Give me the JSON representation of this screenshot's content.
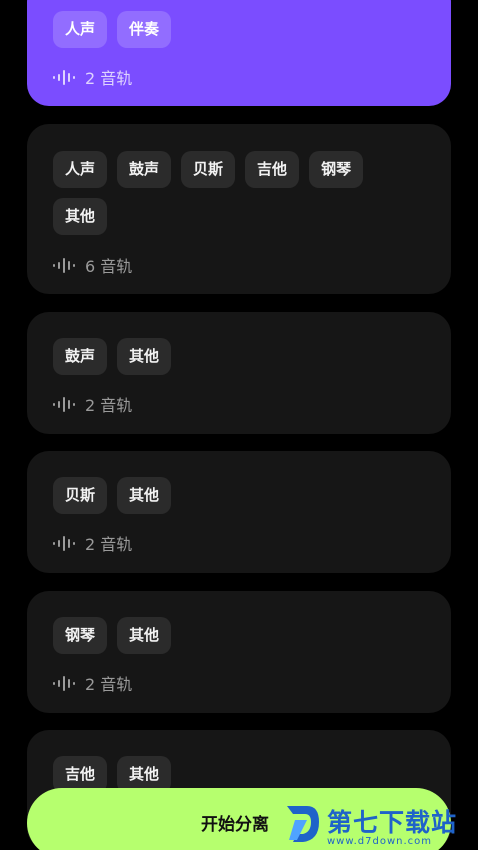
{
  "options": [
    {
      "tags": [
        "人声",
        "伴奏"
      ],
      "track_count": "2 音轨",
      "selected": true
    },
    {
      "tags": [
        "人声",
        "鼓声",
        "贝斯",
        "吉他",
        "钢琴",
        "其他"
      ],
      "track_count": "6 音轨",
      "selected": false
    },
    {
      "tags": [
        "鼓声",
        "其他"
      ],
      "track_count": "2 音轨",
      "selected": false
    },
    {
      "tags": [
        "贝斯",
        "其他"
      ],
      "track_count": "2 音轨",
      "selected": false
    },
    {
      "tags": [
        "钢琴",
        "其他"
      ],
      "track_count": "2 音轨",
      "selected": false
    },
    {
      "tags": [
        "吉他",
        "其他"
      ],
      "selected": false
    }
  ],
  "action": {
    "label": "开始分离"
  },
  "watermark": {
    "text": "第七下载站",
    "url": "www.d7down.com"
  },
  "icons": {
    "track": "waveform-icon"
  },
  "colors": {
    "selected": "#7b4dff",
    "card": "#161616",
    "cta": "#b6ff6e",
    "watermark": "#1f63c9"
  }
}
